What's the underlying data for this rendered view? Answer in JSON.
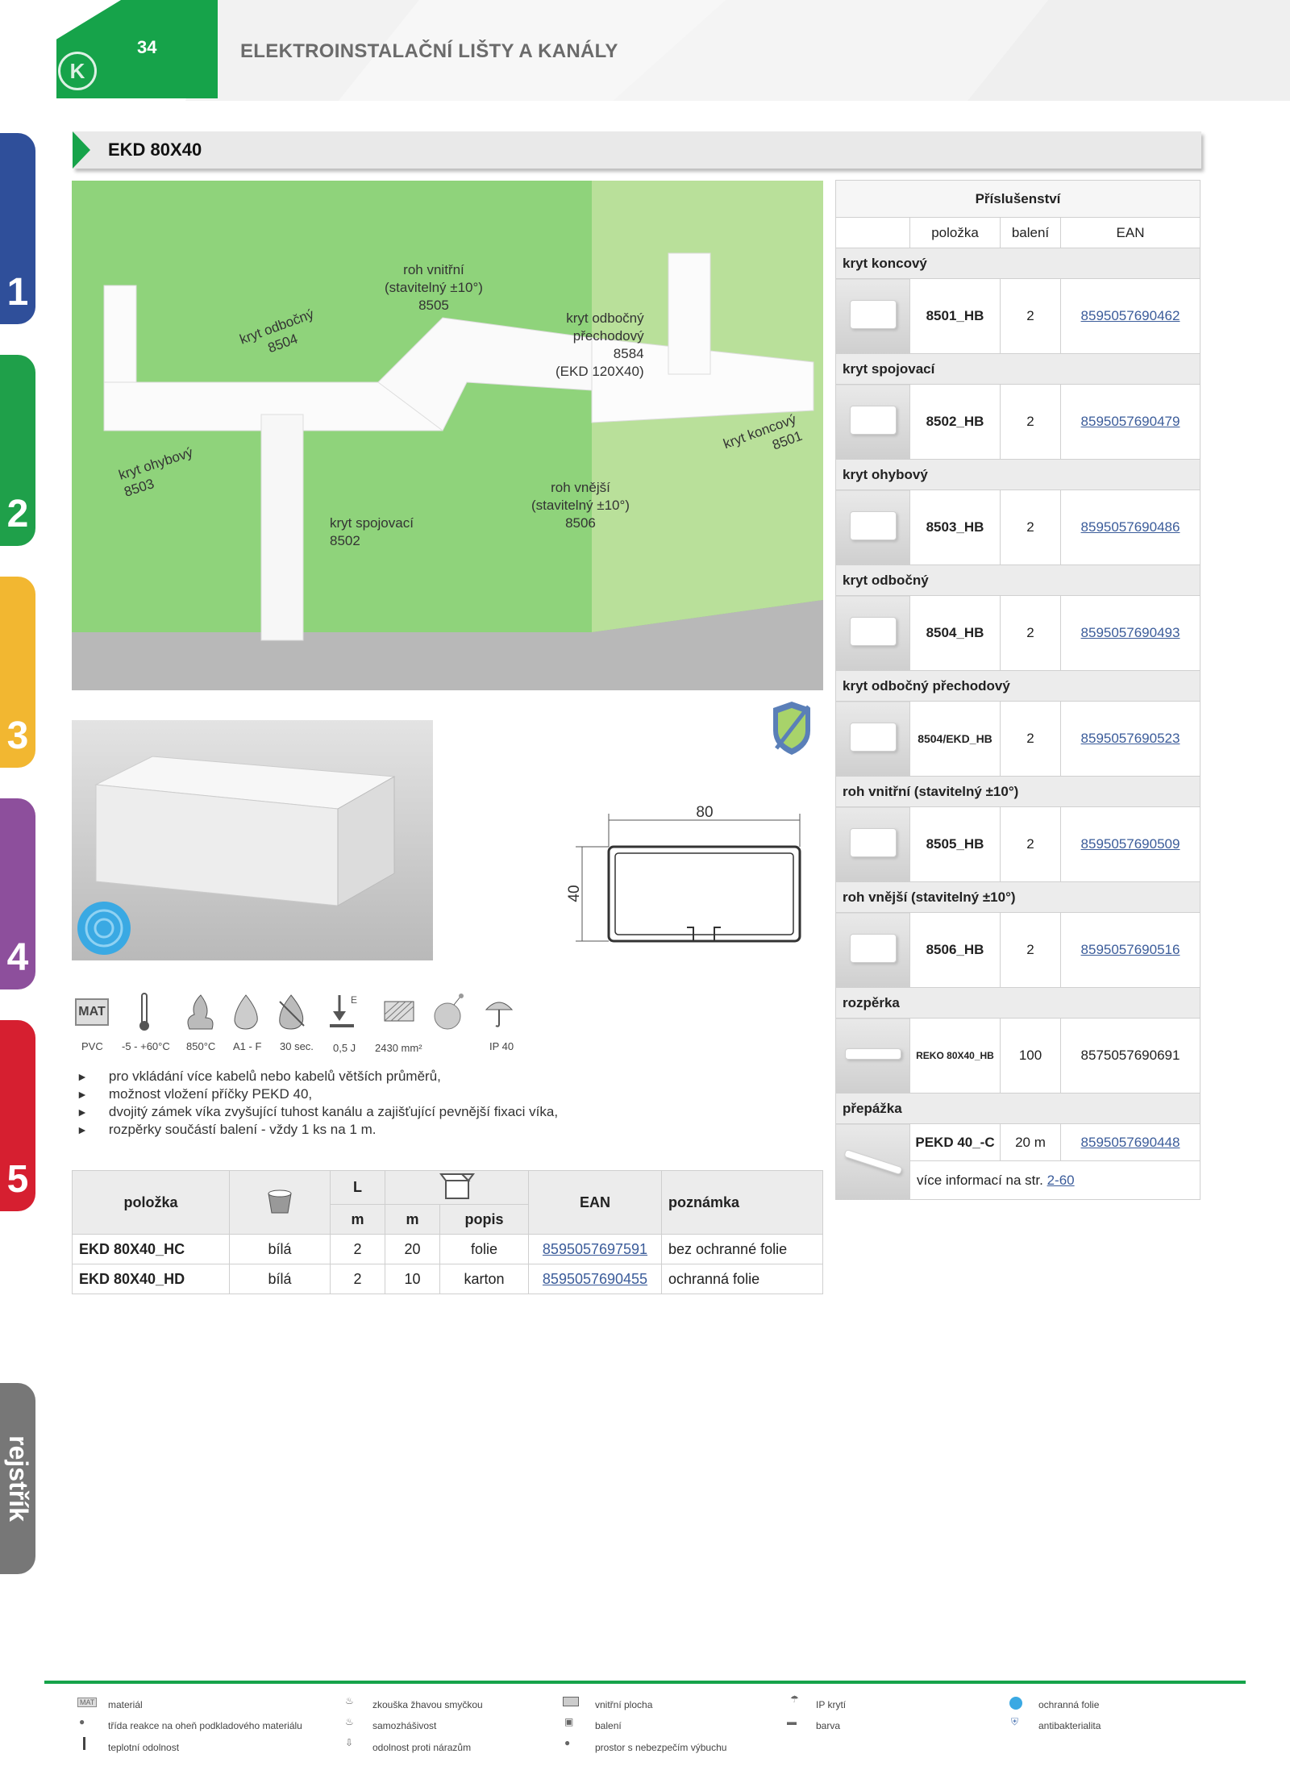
{
  "header": {
    "page_number": "34",
    "title": "ELEKTROINSTALAČNÍ LIŠTY A KANÁLY",
    "logo_text": "K"
  },
  "side_tabs": [
    {
      "label": "1",
      "color": "#2f4f9a"
    },
    {
      "label": "2",
      "color": "#1fa04a"
    },
    {
      "label": "3",
      "color": "#f2b731"
    },
    {
      "label": "4",
      "color": "#8d4f9c"
    },
    {
      "label": "5",
      "color": "#d61f30"
    }
  ],
  "side_index": "rejstřík",
  "section": {
    "title": "EKD 80X40"
  },
  "photo_labels": {
    "l1": "roh vnitřní",
    "l2": "(stavitelný ±10°)",
    "l3": "8505",
    "l4": "kryt odbočný",
    "l5": "8504",
    "l6": "kryt odbočný",
    "l7": "přechodový",
    "l8": "8584",
    "l9": "(EKD 120X40)",
    "l10": "kryt ohybový",
    "l11": "8503",
    "l12": "kryt koncový",
    "l13": "8501",
    "l14": "roh vnější",
    "l15": "(stavitelný ±10°)",
    "l16": "8506",
    "l17": "kryt spojovací",
    "l18": "8502"
  },
  "dimension": {
    "width": "80",
    "height": "40"
  },
  "properties": [
    {
      "icon": "mat-icon",
      "label": "PVC"
    },
    {
      "icon": "thermometer-icon",
      "label": "-5 - +60°C"
    },
    {
      "icon": "glow-wire-icon",
      "label": "850°C"
    },
    {
      "icon": "flame-class-icon",
      "label": "A1 - F"
    },
    {
      "icon": "self-extinguishing-icon",
      "label": "30 sec."
    },
    {
      "icon": "impact-icon",
      "label": "0,5 J"
    },
    {
      "icon": "area-icon",
      "label": "2430 mm²"
    },
    {
      "icon": "explosion-icon",
      "label": ""
    },
    {
      "icon": "ip-icon",
      "label": "IP 40"
    }
  ],
  "bullets": [
    "pro vkládání více kabelů nebo kabelů větších průměrů,",
    "možnost vložení příčky PEKD 40,",
    "dvojitý zámek víka zvyšující tuhost kanálu a zajišťující pevnější fixaci víka,",
    "rozpěrky součástí balení - vždy 1 ks na 1 m."
  ],
  "main_table": {
    "h_item": "položka",
    "h_L": "L",
    "h_m1": "m",
    "h_m2": "m",
    "h_popis": "popis",
    "h_ean": "EAN",
    "h_note": "poznámka",
    "rows": [
      {
        "item": "EKD 80X40_HC",
        "color": "bílá",
        "L": "2",
        "m": "20",
        "popis": "folie",
        "ean": "8595057697591",
        "note": "bez ochranné folie"
      },
      {
        "item": "EKD 80X40_HD",
        "color": "bílá",
        "L": "2",
        "m": "10",
        "popis": "karton",
        "ean": "8595057690455",
        "note": "ochranná folie"
      }
    ]
  },
  "accessories": {
    "title": "Příslušenství",
    "h_item": "položka",
    "h_pack": "balení",
    "h_ean": "EAN",
    "groups": [
      {
        "name": "kryt koncový",
        "item": "8501_HB",
        "pack": "2",
        "ean": "8595057690462",
        "linked": true
      },
      {
        "name": "kryt spojovací",
        "item": "8502_HB",
        "pack": "2",
        "ean": "8595057690479",
        "linked": true
      },
      {
        "name": "kryt ohybový",
        "item": "8503_HB",
        "pack": "2",
        "ean": "8595057690486",
        "linked": true
      },
      {
        "name": "kryt odbočný",
        "item": "8504_HB",
        "pack": "2",
        "ean": "8595057690493",
        "linked": true
      },
      {
        "name": "kryt odbočný přechodový",
        "item": "8504/EKD_HB",
        "pack": "2",
        "ean": "8595057690523",
        "linked": true
      },
      {
        "name": "roh vnitřní (stavitelný ±10°)",
        "item": "8505_HB",
        "pack": "2",
        "ean": "8595057690509",
        "linked": true
      },
      {
        "name": "roh vnější (stavitelný ±10°)",
        "item": "8506_HB",
        "pack": "2",
        "ean": "8595057690516",
        "linked": true
      },
      {
        "name": "rozpěrka",
        "item": "REKO 80X40_HB",
        "pack": "100",
        "ean": "8575057690691",
        "linked": false
      },
      {
        "name": "přepážka",
        "item": "PEKD 40_-C",
        "pack": "20 m",
        "ean": "8595057690448",
        "linked": true
      }
    ],
    "more_text": "více informací na str.",
    "more_link": "2-60"
  },
  "legend": [
    "materiál",
    "zkouška žhavou smyčkou",
    "vnitřní plocha",
    "IP krytí",
    "ochranná folie",
    "třída reakce na oheň podkladového materiálu",
    "samozhášivost",
    "balení",
    "barva",
    "antibakterialita",
    "teplotní odolnost",
    "odolnost proti nárazům",
    "prostor s nebezpečím výbuchu"
  ],
  "legend_icons": {
    "mat": "MAT"
  }
}
